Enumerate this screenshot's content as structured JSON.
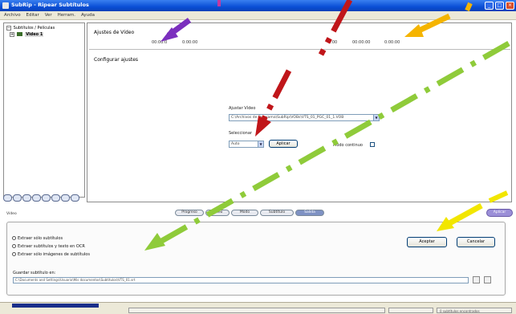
{
  "window": {
    "title": "SubRip - Ripear Subtítulos"
  },
  "menu": [
    "Archivo",
    "Editar",
    "Ver",
    "Herram.",
    "Ayuda"
  ],
  "tree": {
    "root": "Subtítulos / Películas",
    "selected": "Video 1"
  },
  "panel": {
    "section1_title": "Ajustes de Vídeo",
    "row1_values": [
      "00:00:0",
      "0:00:00",
      "0:00",
      "00:00:00",
      "0:00:00"
    ],
    "section2_title": "Configurar ajustes",
    "group_label": "Ajustar Vídeo",
    "combo_value": "C:\\Archivos de Programa\\SubRip\\VOBs\\VTS_01_PGC_01_1.VOB",
    "select_label": "Seleccionar",
    "select_value": "Auto",
    "apply_button": "Aplicar",
    "checkbox_label": "Modo continuo"
  },
  "tabs": [
    "Progreso",
    "Vídeo",
    "Modo",
    "Subtítulo",
    "Salida"
  ],
  "active_tab_index": 4,
  "right_tab": "Aplicar",
  "below_tree_label": "Vídeo",
  "options": {
    "items": [
      "Extraer sólo subtítulos",
      "Extraer subtítulos y texto en OCR",
      "Extraer sólo imágenes de subtítulos"
    ],
    "destination_label": "Guardar subtítulo en:",
    "destination_path": "C:\\Documents and Settings\\Usuario\\Mis documentos\\Subtítulos\\VTS_01.srt",
    "accept_button": "Aceptar",
    "cancel_button": "Cancelar"
  },
  "status": {
    "progress": 0.18,
    "text": "0 subtítulos encontrados"
  },
  "colors": {
    "arrow_purple": "#7b2fbe",
    "arrow_red": "#c0161a",
    "arrow_orange": "#f5b400",
    "arrow_green": "#8fcb3a",
    "arrow_yellow": "#f2e600"
  }
}
